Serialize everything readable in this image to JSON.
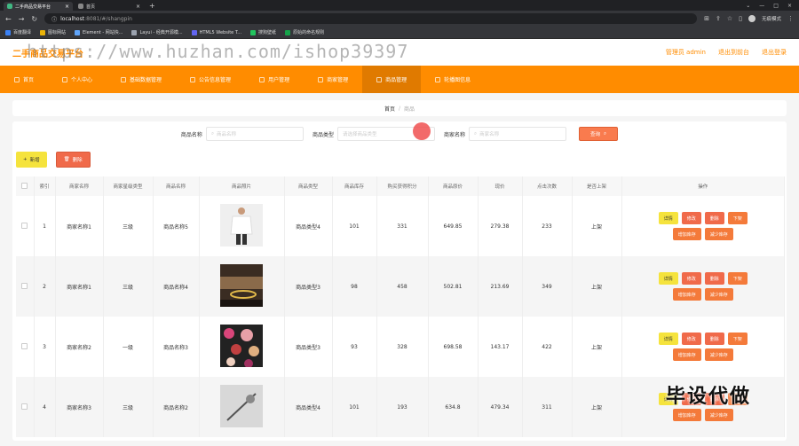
{
  "browser": {
    "tabs": [
      {
        "label": "二手商品交易平台",
        "active": true
      },
      {
        "label": "首页",
        "active": false
      }
    ],
    "url_host": "localhost",
    "url_rest": ":8081/#/shangpin",
    "profile": "无痕模式",
    "bookmarks": [
      "百度翻译",
      "图标网站",
      "Element - 网站快...",
      "Layui - 经典开源模...",
      "HTML5 Website T...",
      "搜狗壁纸",
      "原始的命名规则"
    ]
  },
  "header": {
    "brand": "二手商品交易平台",
    "watermark": "https://www.huzhan.com/ishop39397",
    "links": [
      "管理员 admin",
      "退出到前台",
      "退出登录"
    ]
  },
  "nav": {
    "items": [
      "首页",
      "个人中心",
      "基础数据管理",
      "公告信息管理",
      "用户管理",
      "商家管理",
      "商品管理",
      "轮播图信息"
    ],
    "active_index": 6
  },
  "breadcrumb": {
    "home": "首页",
    "sep": "/",
    "current": "商品"
  },
  "search": {
    "name_label": "商品名称",
    "name_placeholder": "商品名称",
    "type_label": "商品类型",
    "type_placeholder": "请选择商品类型",
    "shop_label": "商家名称",
    "shop_placeholder": "商家名称",
    "button": "查询"
  },
  "actions": {
    "add": "新增",
    "delete": "删除"
  },
  "table": {
    "headers": [
      "索引",
      "商家名称",
      "商家星级类型",
      "商品名称",
      "商品照片",
      "商品类型",
      "商品库存",
      "购买获得积分",
      "商品原价",
      "现价",
      "点击次数",
      "是否上架",
      "操作"
    ],
    "rows": [
      {
        "index": "1",
        "shop": "商家名称1",
        "star": "三级",
        "name": "商品名称5",
        "photo": "white-shirt",
        "type": "商品类型4",
        "stock": "101",
        "points": "331",
        "orig": "649.85",
        "price": "279.38",
        "clicks": "233",
        "status": "上架"
      },
      {
        "index": "2",
        "shop": "商家名称1",
        "star": "三级",
        "name": "商品名称4",
        "photo": "gold-ring",
        "type": "商品类型3",
        "stock": "98",
        "points": "458",
        "orig": "502.81",
        "price": "213.69",
        "clicks": "349",
        "status": "上架"
      },
      {
        "index": "3",
        "shop": "商家名称2",
        "star": "一级",
        "name": "商品名称3",
        "photo": "cosmetics",
        "type": "商品类型3",
        "stock": "93",
        "points": "328",
        "orig": "698.58",
        "price": "143.17",
        "clicks": "422",
        "status": "上架"
      },
      {
        "index": "4",
        "shop": "商家名称3",
        "star": "三级",
        "name": "商品名称2",
        "photo": "hair-clip",
        "type": "商品类型4",
        "stock": "101",
        "points": "193",
        "orig": "634.8",
        "price": "479.34",
        "clicks": "311",
        "status": "上架"
      }
    ],
    "ops": {
      "detail": "详情",
      "edit": "修改",
      "delete": "删除",
      "off": "下架",
      "add_stock": "增加库存",
      "reduce_stock": "减少库存"
    }
  },
  "overlay": "毕设代做",
  "colors": {
    "accent": "#ff8c00",
    "danger": "#f06a4a",
    "warn": "#f5e33d"
  }
}
